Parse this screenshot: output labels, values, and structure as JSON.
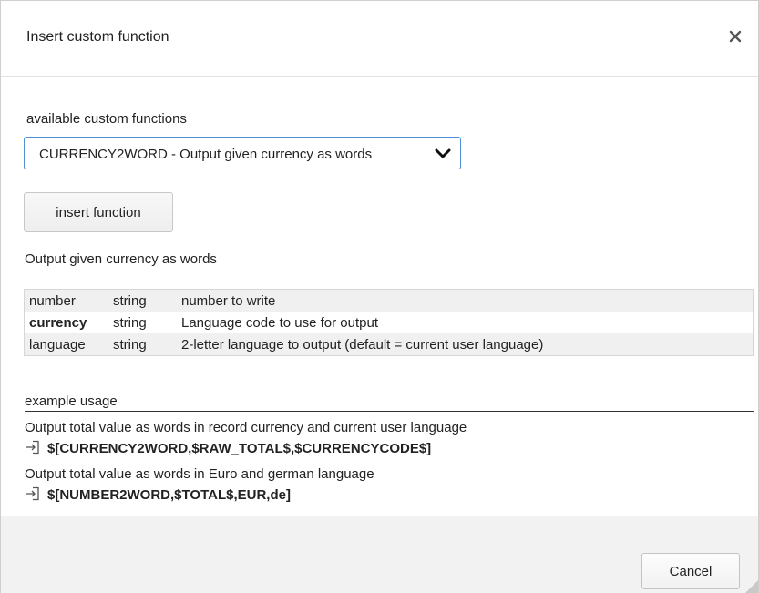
{
  "dialog": {
    "title": "Insert custom function",
    "close_icon": "close-icon"
  },
  "functions": {
    "label": "available custom functions",
    "selected": "CURRENCY2WORD - Output given currency as words",
    "chevron_icon": "chevron-down-icon"
  },
  "insert_button": {
    "label": "insert function"
  },
  "description": "Output given currency as words",
  "parameters": [
    {
      "name": "number",
      "type": "string",
      "description": "number to write"
    },
    {
      "name": "currency",
      "type": "string",
      "description": "Language code to use for output"
    },
    {
      "name": "language",
      "type": "string",
      "description": "2-letter language to output (default = current user language)"
    }
  ],
  "examples": {
    "header": "example usage",
    "items": [
      {
        "description": "Output total value as words in record currency and current user language",
        "code": "$[CURRENCY2WORD,$RAW_TOTAL$,$CURRENCYCODE$]"
      },
      {
        "description": "Output total value as words in Euro and german language",
        "code": "$[NUMBER2WORD,$TOTAL$,EUR,de]"
      }
    ],
    "insert_icon": "insert-icon"
  },
  "footer": {
    "cancel_label": "Cancel",
    "resize_icon": "resize-grip-icon"
  },
  "colors": {
    "select_border": "#4f8fd6",
    "footer_bg": "#f2f2f2",
    "table_alt_row": "#f0f0f0"
  }
}
